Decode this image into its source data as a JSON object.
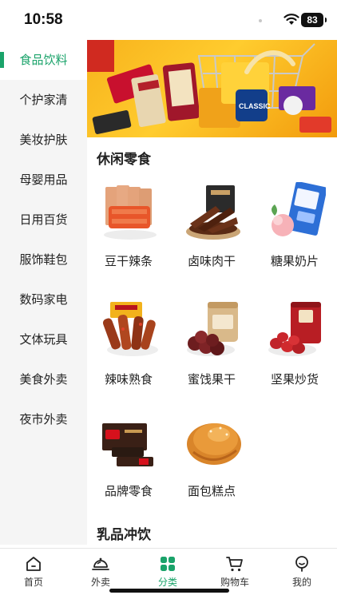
{
  "status_bar": {
    "time": "10:58",
    "battery": "83"
  },
  "sidebar": {
    "items": [
      {
        "label": "食品饮料",
        "active": true
      },
      {
        "label": "个护家清"
      },
      {
        "label": "美妆护肤"
      },
      {
        "label": "母婴用品"
      },
      {
        "label": "日用百货"
      },
      {
        "label": "服饰鞋包"
      },
      {
        "label": "数码家电"
      },
      {
        "label": "文体玩具"
      },
      {
        "label": "美食外卖"
      },
      {
        "label": "夜市外卖"
      }
    ]
  },
  "main": {
    "banner": {
      "classic_text": "CLASSIC"
    },
    "sections": [
      {
        "title": "休闲零食",
        "items": [
          {
            "label": "豆干辣条",
            "icon": "spicy-strips-image"
          },
          {
            "label": "卤味肉干",
            "icon": "beef-jerky-image"
          },
          {
            "label": "糖果奶片",
            "icon": "candy-milk-tablet-image"
          },
          {
            "label": "辣味熟食",
            "icon": "spicy-duck-neck-image"
          },
          {
            "label": "蜜饯果干",
            "icon": "dried-fruit-jar-image"
          },
          {
            "label": "坚果炒货",
            "icon": "red-dates-jar-image"
          },
          {
            "label": "品牌零食",
            "icon": "kitkat-box-image"
          },
          {
            "label": "面包糕点",
            "icon": "bread-roll-image"
          }
        ]
      },
      {
        "title": "乳品冲饮"
      }
    ]
  },
  "tabbar": {
    "tabs": [
      {
        "label": "首页",
        "icon": "home-icon"
      },
      {
        "label": "外卖",
        "icon": "cloche-icon"
      },
      {
        "label": "分类",
        "icon": "category-grid-icon",
        "active": true
      },
      {
        "label": "购物车",
        "icon": "cart-icon"
      },
      {
        "label": "我的",
        "icon": "profile-icon"
      }
    ]
  },
  "colors": {
    "accent": "#1aa36a",
    "sidebar_bg": "#f5f5f5"
  }
}
